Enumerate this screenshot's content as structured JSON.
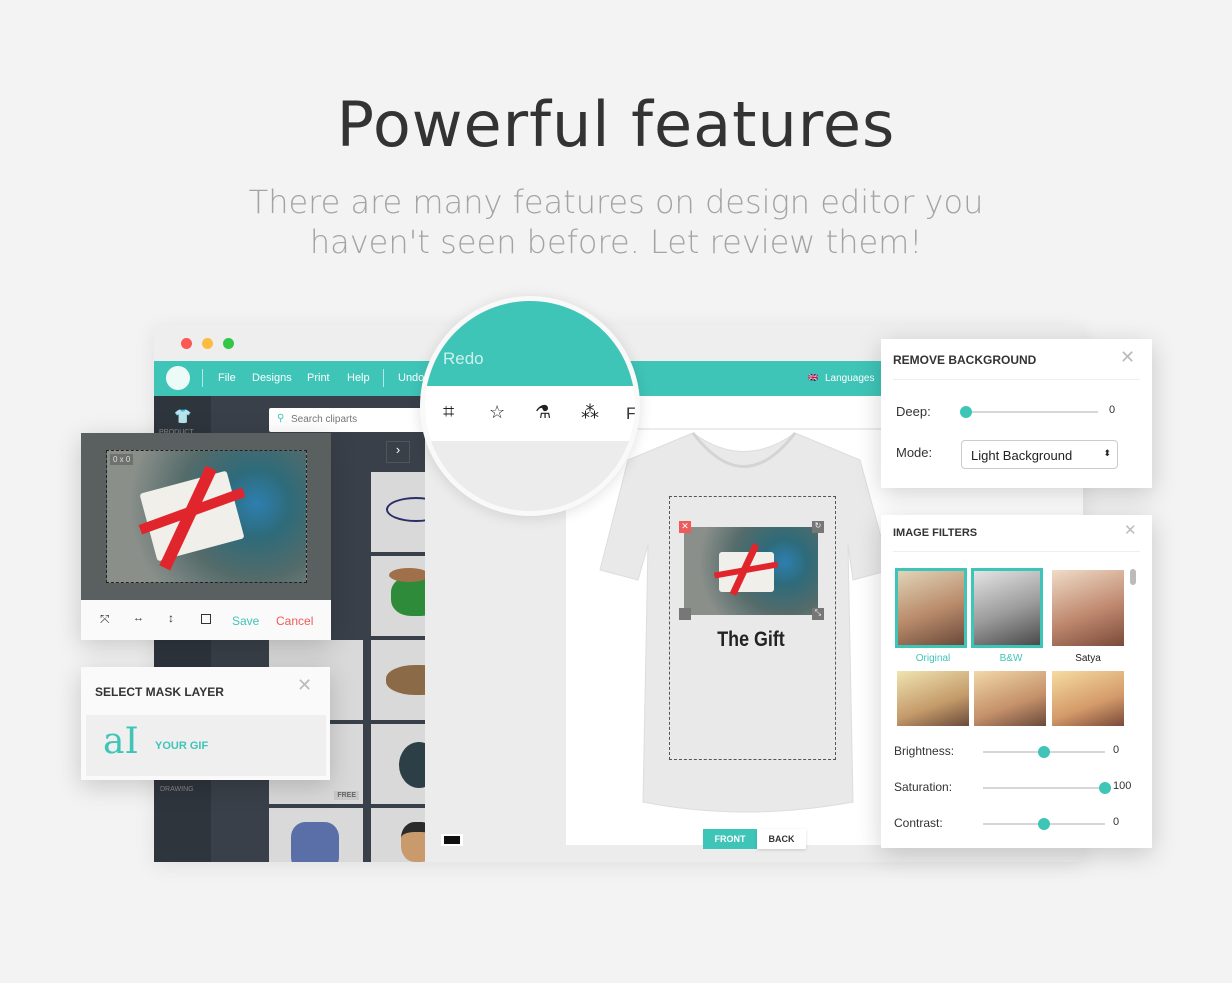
{
  "hero": {
    "title": "Powerful features",
    "subtitle_line1": "There are many features on design editor you",
    "subtitle_line2": "haven't seen before. Let review them!"
  },
  "menu": {
    "items": [
      "File",
      "Designs",
      "Print",
      "Help",
      "Undo"
    ],
    "languages": "Languages"
  },
  "sidebar": {
    "product": "PRODUCT",
    "drawing": "DRAWING"
  },
  "cliparts": {
    "search_placeholder": "Search cliparts",
    "badge": "FREE"
  },
  "magnifier": {
    "redo": "Redo",
    "icons": [
      "crop-icon",
      "star-icon",
      "flask-icon",
      "magic-wand-icon"
    ],
    "cut_letter": "F"
  },
  "design": {
    "text": "The Gift",
    "front": "FRONT",
    "back": "BACK"
  },
  "crop": {
    "size": "0 x 0",
    "save": "Save",
    "cancel": "Cancel"
  },
  "mask": {
    "title": "SELECT MASK LAYER",
    "item": "YOUR GIF",
    "glyph": "aI"
  },
  "remove_bg": {
    "title": "REMOVE BACKGROUND",
    "deep_label": "Deep:",
    "deep_value": "0",
    "mode_label": "Mode:",
    "mode_value": "Light Background"
  },
  "filters": {
    "title": "IMAGE FILTERS",
    "thumbs": [
      "Original",
      "B&W",
      "Satya"
    ],
    "brightness_label": "Brightness:",
    "brightness_value": "0",
    "brightness_pos": 0.5,
    "saturation_label": "Saturation:",
    "saturation_value": "100",
    "saturation_pos": 1.0,
    "contrast_label": "Contrast:",
    "contrast_value": "0",
    "contrast_pos": 0.5
  },
  "colors": {
    "accent": "#3fc5b8",
    "cancel": "#f05a5a",
    "sidebar": "#3a4049"
  }
}
